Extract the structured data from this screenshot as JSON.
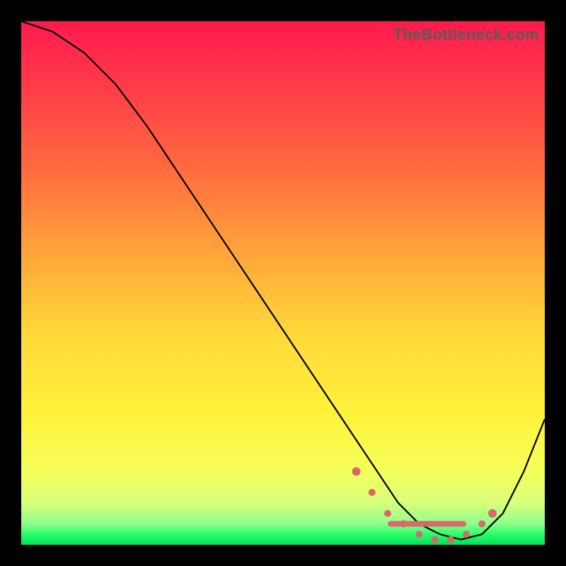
{
  "watermark": "TheBottleneck.com",
  "chart_data": {
    "type": "line",
    "title": "",
    "xlabel": "",
    "ylabel": "",
    "xlim": [
      0,
      100
    ],
    "ylim": [
      0,
      100
    ],
    "series": [
      {
        "name": "bottleneck-curve",
        "x": [
          0,
          6,
          12,
          18,
          24,
          30,
          36,
          42,
          48,
          54,
          60,
          64,
          68,
          72,
          76,
          80,
          84,
          88,
          92,
          96,
          100
        ],
        "y": [
          100,
          98,
          94,
          88,
          80,
          71,
          62,
          53,
          44,
          35,
          26,
          20,
          14,
          8,
          4,
          2,
          1,
          2,
          6,
          14,
          24
        ]
      }
    ],
    "markers": {
      "name": "highlight-band",
      "x": [
        64,
        67,
        70,
        73,
        76,
        79,
        82,
        85,
        88,
        90
      ],
      "y": [
        14,
        10,
        6,
        4,
        2,
        1,
        1,
        2,
        4,
        6
      ]
    },
    "background_gradient": [
      {
        "stop": 0.0,
        "color": "#ff1a4d"
      },
      {
        "stop": 0.45,
        "color": "#ffa73a"
      },
      {
        "stop": 0.75,
        "color": "#fff23a"
      },
      {
        "stop": 0.96,
        "color": "#8cff8c"
      },
      {
        "stop": 1.0,
        "color": "#00e05a"
      }
    ]
  }
}
